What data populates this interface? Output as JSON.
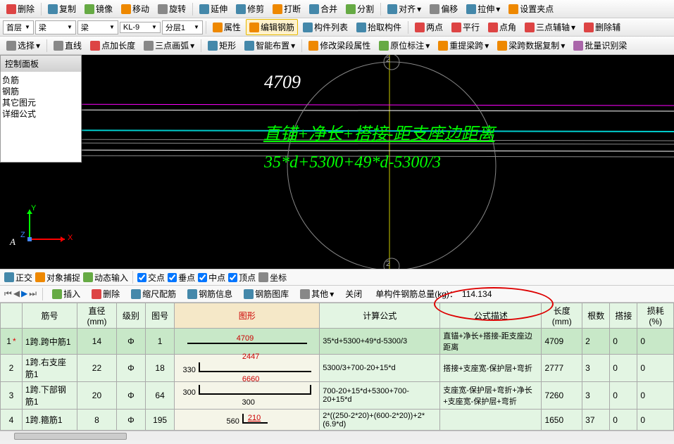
{
  "toolbar1": {
    "delete": "删除",
    "copy": "复制",
    "mirror": "镜像",
    "move": "移动",
    "rotate": "旋转",
    "extend": "延伸",
    "trim": "修剪",
    "break": "打断",
    "merge": "合并",
    "split": "分割",
    "align": "对齐",
    "offset": "偏移",
    "stretch": "拉伸",
    "set_grip": "设置夹点"
  },
  "toolbar2": {
    "floor": "首层",
    "cat1": "梁",
    "cat2": "梁",
    "comp": "KL-9",
    "span": "分层1",
    "attrs": "属性",
    "edit_rebar": "编辑钢筋",
    "list": "构件列表",
    "pick": "抬取构件",
    "two_pt": "两点",
    "parallel": "平行",
    "angle": "点角",
    "three_axis": "三点辅轴",
    "del_axis": "删除辅"
  },
  "toolbar3": {
    "select": "选择",
    "line": "直线",
    "pt_len": "点加长度",
    "arc3": "三点画弧",
    "rect": "矩形",
    "smart": "智能布置",
    "edit_span": "修改梁段属性",
    "mark": "原位标注",
    "redo_span": "重提梁跨",
    "copy_span": "梁跨数据复制",
    "batch": "批量识别梁"
  },
  "panel": {
    "title": "控制面板",
    "i1": "负筋",
    "i2": "钢筋",
    "i3": "其它图元",
    "i4": "详细公式"
  },
  "canvas": {
    "num": "4709",
    "formula1": "直锚+净长+搭接-距支座边距离",
    "formula2": "35*d+5300+49*d-5300/3",
    "tick": "2",
    "A": "A",
    "X": "X",
    "Y": "Y",
    "Z": "Z"
  },
  "snapbar": {
    "ortho": "正交",
    "osnap": "对象捕捉",
    "dyn": "动态输入",
    "inter": "交点",
    "perp": "垂点",
    "mid": "中点",
    "apex": "顶点",
    "coord": "坐标"
  },
  "tabbar": {
    "insert": "插入",
    "delete": "删除",
    "scale": "缩尺配筋",
    "info": "钢筋信息",
    "lib": "钢筋图库",
    "other": "其他",
    "close": "关闭",
    "total_label": "单构件钢筋总量(kg)：",
    "total_val": "114.134"
  },
  "grid": {
    "headers": {
      "no": "筋号",
      "dia": "直径(mm)",
      "grade": "级别",
      "fig_no": "图号",
      "fig": "图形",
      "calc": "计算公式",
      "desc": "公式描述",
      "len": "长度(mm)",
      "qty": "根数",
      "lap": "搭接",
      "loss": "损耗(%)"
    },
    "rows": [
      {
        "n": "1",
        "mark": "*",
        "name": "1跨.跨中筋1",
        "dia": "14",
        "grade": "Φ",
        "fig_no": "1",
        "fig": {
          "type": "line",
          "top": "4709"
        },
        "calc": "35*d+5300+49*d-5300/3",
        "desc": "直锚+净长+搭接-距支座边距离",
        "len": "4709",
        "qty": "2",
        "lap": "0",
        "loss": "0"
      },
      {
        "n": "2",
        "name": "1跨.右支座筋1",
        "dia": "22",
        "grade": "Φ",
        "fig_no": "18",
        "fig": {
          "type": "L",
          "left": "330",
          "top": "2447"
        },
        "calc": "5300/3+700-20+15*d",
        "desc": "搭接+支座宽-保护层+弯折",
        "len": "2777",
        "qty": "3",
        "lap": "0",
        "loss": "0"
      },
      {
        "n": "3",
        "name": "1跨.下部钢筋1",
        "dia": "20",
        "grade": "Φ",
        "fig_no": "64",
        "fig": {
          "type": "U",
          "left": "300",
          "top": "6660",
          "right": "300"
        },
        "calc": "700-20+15*d+5300+700-20+15*d",
        "desc": "支座宽-保护层+弯折+净长+支座宽-保护层+弯折",
        "len": "7260",
        "qty": "3",
        "lap": "0",
        "loss": "0"
      },
      {
        "n": "4",
        "name": "1跨.箍筋1",
        "dia": "8",
        "grade": "Φ",
        "fig_no": "195",
        "fig": {
          "type": "hook",
          "left": "560",
          "top": "210"
        },
        "calc": "2*((250-2*20)+(600-2*20))+2*(6.9*d)",
        "desc": "",
        "len": "1650",
        "qty": "37",
        "lap": "0",
        "loss": "0"
      }
    ]
  }
}
